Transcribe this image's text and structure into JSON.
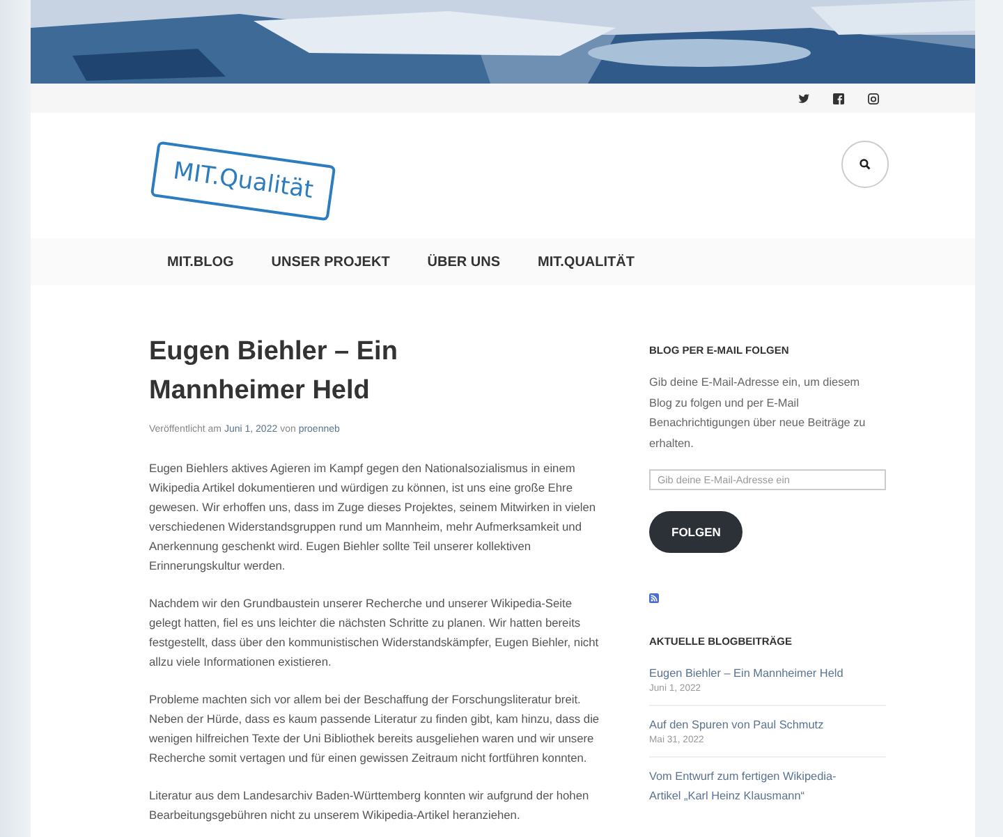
{
  "social": {
    "links": [
      {
        "kind": "twitter"
      },
      {
        "kind": "facebook"
      },
      {
        "kind": "instagram"
      }
    ]
  },
  "logo": {
    "text": "MIT.Qualität"
  },
  "nav": {
    "items": [
      {
        "label": "MIT.BLOG"
      },
      {
        "label": "UNSER PROJEKT"
      },
      {
        "label": "ÜBER UNS"
      },
      {
        "label": "MIT.QUALITÄT"
      }
    ]
  },
  "post": {
    "title": "Eugen Biehler – Ein Mannheimer Held",
    "meta": {
      "prefix": "Veröffentlicht am",
      "date": "Juni 1, 2022",
      "by": "von",
      "author": "proenneb"
    },
    "paragraphs": [
      "Eugen Biehlers aktives Agieren im Kampf gegen den Nationalsozialismus in einem Wikipedia Artikel dokumentieren und würdigen zu können, ist uns eine große Ehre gewesen. Wir erhoffen uns, dass im Zuge dieses Projektes, seinem Mitwirken in vielen verschiedenen Widerstandsgruppen rund um Mannheim, mehr Aufmerksamkeit und Anerkennung geschenkt wird. Eugen Biehler sollte Teil unserer kollektiven Erinnerungskultur werden.",
      "Nachdem wir den Grundbaustein unserer Recherche und unserer Wikipedia-Seite gelegt hatten, fiel es uns leichter die nächsten Schritte zu planen. Wir hatten bereits festgestellt, dass über den kommunistischen Widerstandskämpfer, Eugen Biehler, nicht allzu viele Informationen existieren.",
      "Probleme machten sich vor allem bei der Beschaffung der Forschungsliteratur breit. Neben der Hürde, dass es kaum passende Literatur zu finden gibt, kam hinzu, dass die wenigen hilfreichen Texte der Uni Bibliothek bereits ausgeliehen waren und wir unsere Recherche somit vertagen und für einen gewissen Zeitraum nicht fortführen konnten.",
      "Literatur aus dem Landesarchiv Baden-Württemberg konnten wir aufgrund der hohen Bearbeitungsgebühren nicht zu unserem Wikipedia-Artikel heranziehen."
    ]
  },
  "sidebar": {
    "follow": {
      "title": "BLOG PER E-MAIL FOLGEN",
      "text": "Gib deine E-Mail-Adresse ein, um diesem Blog zu folgen und per E-Mail Benachrichtigungen über neue Beiträge zu erhalten.",
      "placeholder": "Gib deine E-Mail-Adresse ein",
      "button": "FOLGEN"
    },
    "recent": {
      "title": "AKTUELLE BLOGBEITRÄGE",
      "posts": [
        {
          "title": "Eugen Biehler – Ein Mannheimer Held",
          "date": "Juni 1, 2022"
        },
        {
          "title": "Auf den Spuren von Paul Schmutz",
          "date": "Mai 31, 2022"
        },
        {
          "title": "Vom Entwurf zum fertigen Wikipedia-Artikel „Karl Heinz Klausmann“"
        }
      ]
    }
  }
}
